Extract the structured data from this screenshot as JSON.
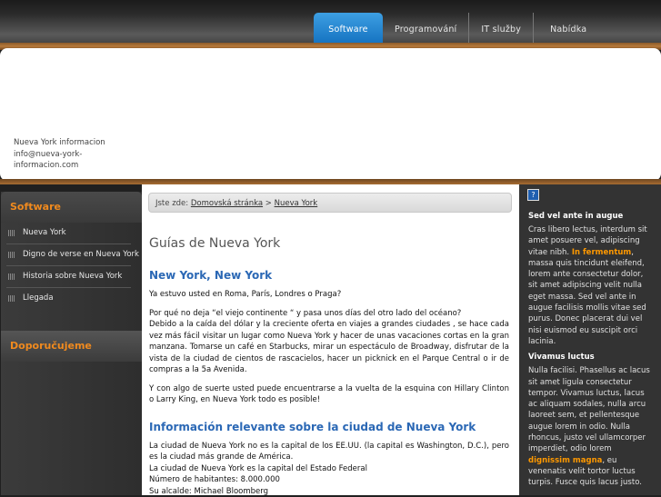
{
  "nav": {
    "items": [
      "Software",
      "Programování",
      "IT služby",
      "Nabídka"
    ]
  },
  "header": {
    "contact_lines": [
      "Nueva York informacion",
      "info@nueva-york-informacion.com"
    ]
  },
  "sidebar": {
    "heading": "Software",
    "items": [
      "Nueva York",
      "Digno de verse en Nueva York",
      "Historia sobre Nueva York",
      "Llegada"
    ],
    "recommend_heading": "Doporučujeme"
  },
  "breadcrumb": {
    "prefix": "Jste zde:",
    "home": "Domovská stránka",
    "separator": ">",
    "current": "Nueva York"
  },
  "main": {
    "title": "Guías de Nueva York",
    "section1_heading": "New York, New York",
    "p1": "Ya estuvo usted en Roma, París, Londres o Praga?",
    "p2a": "Por qué no deja “el viejo continente “ y pasa unos días del otro lado del océano?",
    "p2b": "Debido a la caída del dólar y la creciente oferta en viajes a grandes ciudades , se hace cada vez más fácil visitar un lugar como Nueva York y hacer de unas vacaciones cortas en la gran manzana. Tomarse un café en Starbucks, mirar un espectáculo de Broadway, disfrutar de la vista de la ciudad de cientos de rascacielos, hacer un picknick en el Parque Central o ir de compras a la 5a Avenida.",
    "p3": "Y con algo de suerte usted puede encuentrarse a la vuelta de la esquina con Hillary Clinton o Larry King, en Nueva York todo es posible!",
    "section2_heading": "Información relevante sobre la ciudad de Nueva York",
    "p4a": "La ciudad de Nueva York no es la capital de los EE.UU. (la capital es Washington, D.C.), pero es la ciudad más grande de América.",
    "p4b": "La ciudad de Nueva York es la capital del Estado Federal",
    "p4c": "Número de habitantes: 8.000.000",
    "p4d": "Su alcalde: Michael Bloomberg"
  },
  "right": {
    "icon": "?",
    "title1": "Sed vel ante in augue",
    "text1_a": "Cras libero lectus, interdum sit amet posuere vel, adipiscing vitae nibh. ",
    "text1_hl": "In fermentum",
    "text1_b": ", massa quis tincidunt eleifend, lorem ante consectetur dolor, sit amet adipiscing velit nulla eget massa. Sed vel ante in augue facilisis mollis vitae sed purus. Donec placerat dui vel nisi euismod eu suscipit orci lacinia.",
    "title2": "Vivamus luctus",
    "text2_a": "Nulla facilisi. Phasellus ac lacus sit amet ligula consectetur tempor. Vivamus luctus, lacus ac aliquam sodales, nulla arcu laoreet sem, et pellentesque augue lorem in odio. Nulla rhoncus, justo vel ullamcorper imperdiet, odio lorem ",
    "text2_hl": "dignissim magna",
    "text2_b": ", eu venenatis velit tortor luctus turpis. Fusce quis lacus justo."
  }
}
